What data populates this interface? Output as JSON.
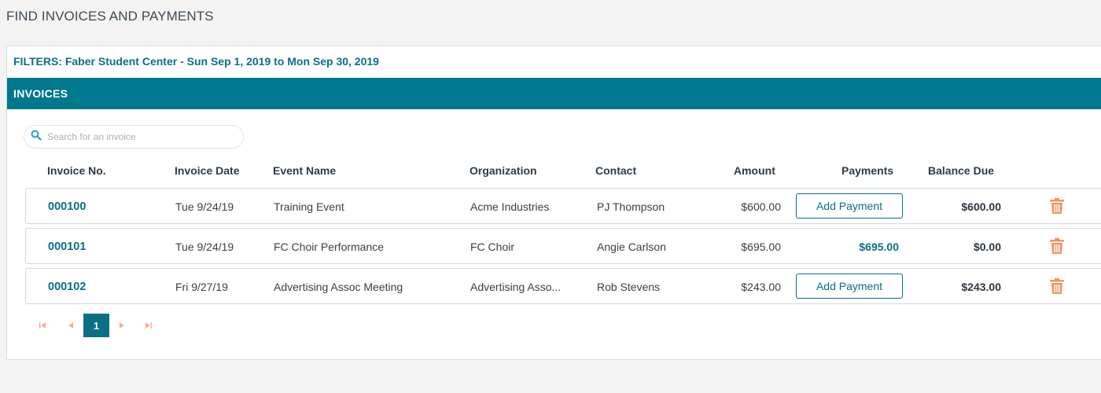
{
  "page": {
    "title": "FIND INVOICES AND PAYMENTS"
  },
  "filters": {
    "label": "FILTERS: Faber Student Center - Sun Sep 1, 2019 to Mon Sep 30, 2019"
  },
  "section": {
    "title": "INVOICES"
  },
  "search": {
    "placeholder": "Search for an invoice",
    "value": ""
  },
  "table": {
    "headers": [
      "Invoice No.",
      "Invoice Date",
      "Event Name",
      "Organization",
      "Contact",
      "Amount",
      "Payments",
      "Balance Due"
    ],
    "rows": [
      {
        "invoice_no": "000100",
        "date": "Tue 9/24/19",
        "event": "Training Event",
        "organization": "Acme Industries",
        "contact": "PJ Thompson",
        "amount": "$600.00",
        "payment_action": "Add Payment",
        "payments": "",
        "balance": "$600.00"
      },
      {
        "invoice_no": "000101",
        "date": "Tue 9/24/19",
        "event": "FC Choir Performance",
        "organization": "FC Choir",
        "contact": "Angie Carlson",
        "amount": "$695.00",
        "payment_action": "",
        "payments": "$695.00",
        "balance": "$0.00"
      },
      {
        "invoice_no": "000102",
        "date": "Fri 9/27/19",
        "event": "Advertising Assoc Meeting",
        "organization": "Advertising Asso...",
        "contact": "Rob Stevens",
        "amount": "$243.00",
        "payment_action": "Add Payment",
        "payments": "",
        "balance": "$243.00"
      }
    ]
  },
  "pagination": {
    "current_page": "1"
  },
  "colors": {
    "accent": "#00788d",
    "link": "#0b6f85",
    "trash": "#f09564",
    "pager_disabled": "#f0b38d"
  }
}
